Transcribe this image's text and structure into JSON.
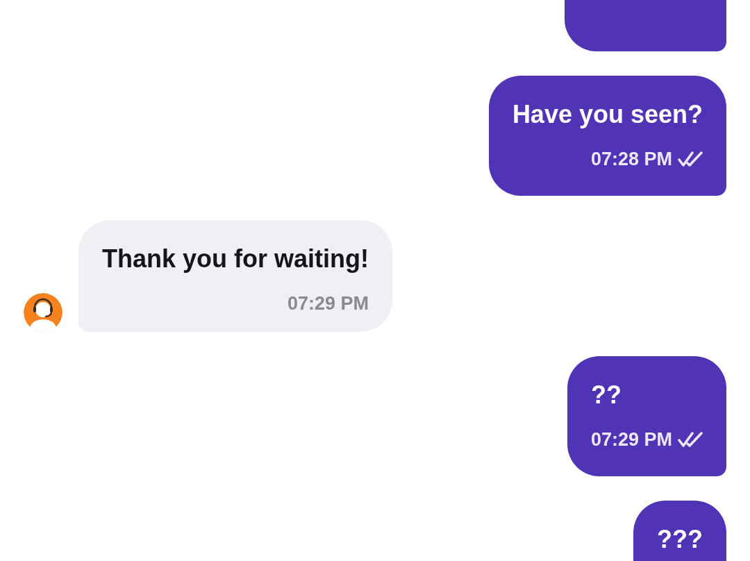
{
  "messages": [
    {
      "kind": "sent"
    },
    {
      "kind": "sent",
      "text": "Have you seen?",
      "time": "07:28 PM"
    },
    {
      "kind": "received",
      "text": "Thank you for waiting!",
      "time": "07:29 PM"
    },
    {
      "kind": "sent",
      "text": "??",
      "time": "07:29 PM"
    },
    {
      "kind": "sent",
      "text": "???"
    }
  ]
}
